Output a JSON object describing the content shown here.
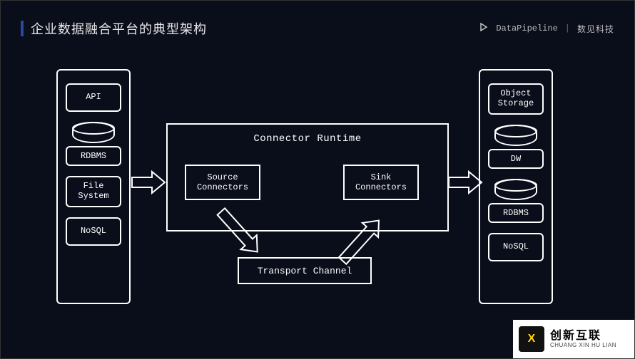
{
  "header": {
    "title": "企业数据融合平台的典型架构",
    "brand_product": "DataPipeline",
    "brand_company": "数见科技"
  },
  "left_column": {
    "items": [
      {
        "kind": "chip",
        "label": "API"
      },
      {
        "kind": "db",
        "label": "RDBMS"
      },
      {
        "kind": "chip2",
        "label_line1": "File",
        "label_line2": "System"
      },
      {
        "kind": "chip",
        "label": "NoSQL"
      }
    ]
  },
  "right_column": {
    "items": [
      {
        "kind": "chip2",
        "label_line1": "Object",
        "label_line2": "Storage"
      },
      {
        "kind": "db",
        "label": "DW"
      },
      {
        "kind": "db",
        "label": "RDBMS"
      },
      {
        "kind": "chip",
        "label": "NoSQL"
      }
    ]
  },
  "runtime": {
    "title": "Connector Runtime",
    "source_box_line1": "Source",
    "source_box_line2": "Connectors",
    "sink_box_line1": "Sink",
    "sink_box_line2": "Connectors"
  },
  "transport": {
    "label": "Transport Channel"
  },
  "watermark": {
    "badge": "X",
    "line1": "创新互联",
    "line2": "CHUANG XIN HU LIAN"
  },
  "arrows": [
    {
      "name": "left-to-runtime",
      "from": "left-column",
      "to": "connector-runtime"
    },
    {
      "name": "source-to-transport",
      "from": "source-connectors",
      "to": "transport-channel"
    },
    {
      "name": "transport-to-sink",
      "from": "transport-channel",
      "to": "sink-connectors"
    },
    {
      "name": "runtime-to-right",
      "from": "connector-runtime",
      "to": "right-column"
    }
  ],
  "colors": {
    "background": "#0a0d1a",
    "line": "#ffffff",
    "title_marker": "#2a4a9f"
  }
}
